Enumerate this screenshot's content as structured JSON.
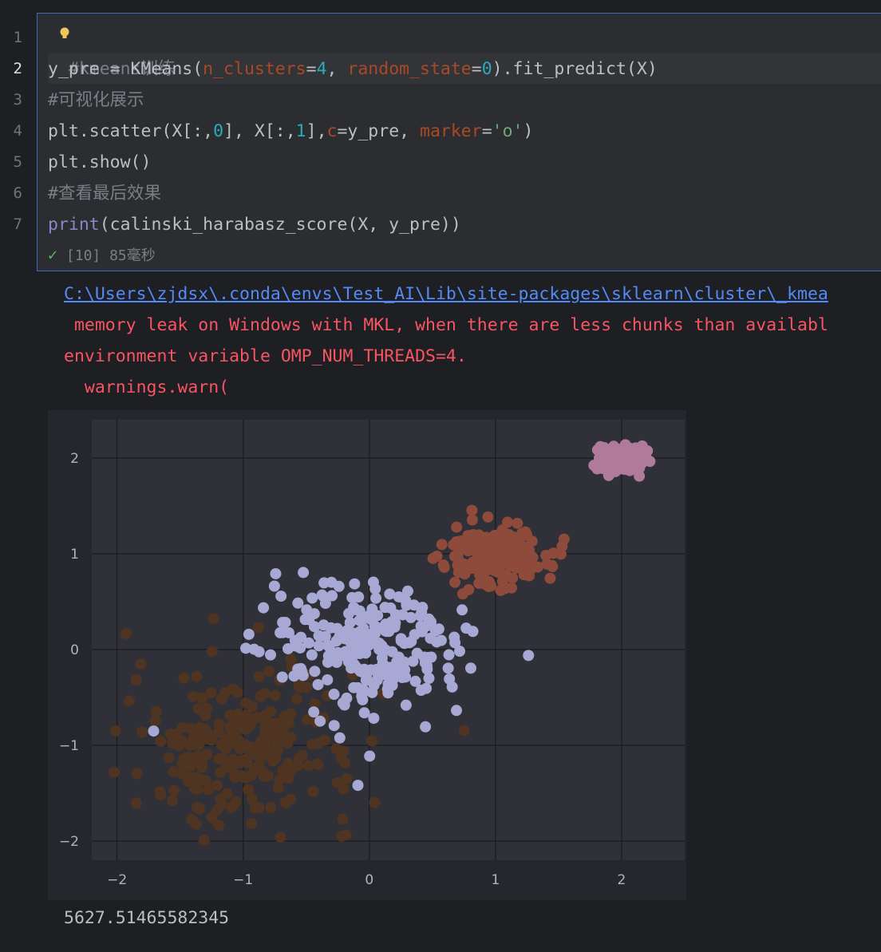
{
  "editor": {
    "line_numbers": [
      "1",
      "2",
      "3",
      "4",
      "5",
      "6",
      "7"
    ],
    "active_line": "2",
    "lines": {
      "l1_comment": "#kmeans训练",
      "l2_a": "y_pre = KMeans(",
      "l2_kw1": "n_clusters",
      "l2_eq1": "=",
      "l2_n1": "4",
      "l2_sep": ", ",
      "l2_kw2": "random_state",
      "l2_eq2": "=",
      "l2_n2": "0",
      "l2_b": ").fit_predict(X)",
      "l3_comment": "#可视化展示",
      "l4_a": "plt.scatter(X[:,",
      "l4_n1": "0",
      "l4_b": "], X[:,",
      "l4_n2": "1",
      "l4_c": "],",
      "l4_kw1": "c",
      "l4_d": "=y_pre, ",
      "l4_kw2": "marker",
      "l4_e": "=",
      "l4_str": "'o'",
      "l4_f": ")",
      "l5": "plt.show()",
      "l6_comment": "#查看最后效果",
      "l7_print": "print",
      "l7_rest": "(calinski_harabasz_score(X, y_pre))"
    },
    "status": {
      "exec_count": "[10]",
      "duration": "85毫秒"
    }
  },
  "output": {
    "warning_path": "C:\\Users\\zjdsx\\.conda\\envs\\Test_AI\\Lib\\site-packages\\sklearn\\cluster\\_kmea",
    "warning_line1": " memory leak on Windows with MKL, when there are less chunks than availabl",
    "warning_line2": "environment variable OMP_NUM_THREADS=4.",
    "warning_line3": "  warnings.warn(",
    "score": "5627.51465582345"
  },
  "colors": {
    "cluster_pink": "#b07a9a",
    "cluster_orange": "#8e4a3a",
    "cluster_lavender": "#a7a9d4",
    "cluster_brown": "#4e3421",
    "plot_bg": "#2f3038",
    "grid": "#1e1f24"
  },
  "chart_data": {
    "type": "scatter",
    "title": "",
    "xlabel": "",
    "ylabel": "",
    "xlim": [
      -2.2,
      2.5
    ],
    "ylim": [
      -2.2,
      2.4
    ],
    "xticks": [
      -2,
      -1,
      0,
      1,
      2
    ],
    "yticks": [
      -2,
      -1,
      0,
      1,
      2
    ],
    "xtick_labels": [
      "−2",
      "−1",
      "0",
      "1",
      "2"
    ],
    "ytick_labels": [
      "−2",
      "−1",
      "0",
      "1",
      "2"
    ],
    "grid": true,
    "legend": "none",
    "series": [
      {
        "cluster": 0,
        "color": "#4e3421",
        "center": [
          -1.0,
          -1.0
        ],
        "spread": [
          0.45,
          0.4
        ],
        "approx_points": 250
      },
      {
        "cluster": 1,
        "color": "#a7a9d4",
        "center": [
          0.0,
          0.0
        ],
        "spread": [
          0.4,
          0.35
        ],
        "approx_points": 250
      },
      {
        "cluster": 2,
        "color": "#8e4a3a",
        "center": [
          1.0,
          1.0
        ],
        "spread": [
          0.2,
          0.16
        ],
        "approx_points": 200
      },
      {
        "cluster": 3,
        "color": "#b07a9a",
        "center": [
          2.0,
          2.0
        ],
        "spread": [
          0.09,
          0.07
        ],
        "approx_points": 120
      }
    ]
  }
}
